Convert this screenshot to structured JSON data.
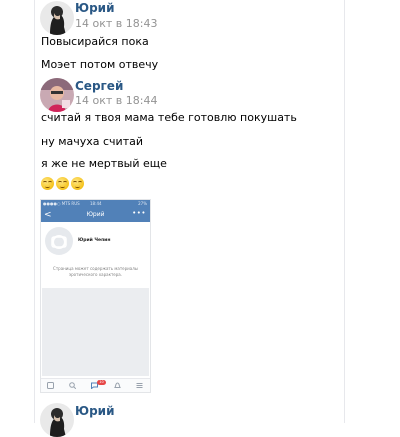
{
  "messages": [
    {
      "author": "Юрий",
      "time": "14 окт в 18:43",
      "lines": [
        "Повысирайся пока",
        "Моэет потом отвечу"
      ]
    },
    {
      "author": "Сергей",
      "time": "14 окт в 18:44",
      "lines": [
        "считай я твоя мама тебе готовлю покушать",
        "ну мачуха считай",
        "я же не мертвый еще"
      ],
      "emoji_count": 3
    },
    {
      "author": "Юрий"
    }
  ],
  "attachment": {
    "status_left": "●●●●○ MTS RUS",
    "status_time": "18:44",
    "status_right": "27%",
    "nav_title": "Юрий",
    "nav_back": "<",
    "nav_more": "•••",
    "profile_name": "Юрий Чепин",
    "warning": "Страница может содержать материалы эротического характера.",
    "badge": "10"
  },
  "colors": {
    "link": "#2a5885",
    "time": "#939393",
    "vk_blue": "#5181b8"
  }
}
